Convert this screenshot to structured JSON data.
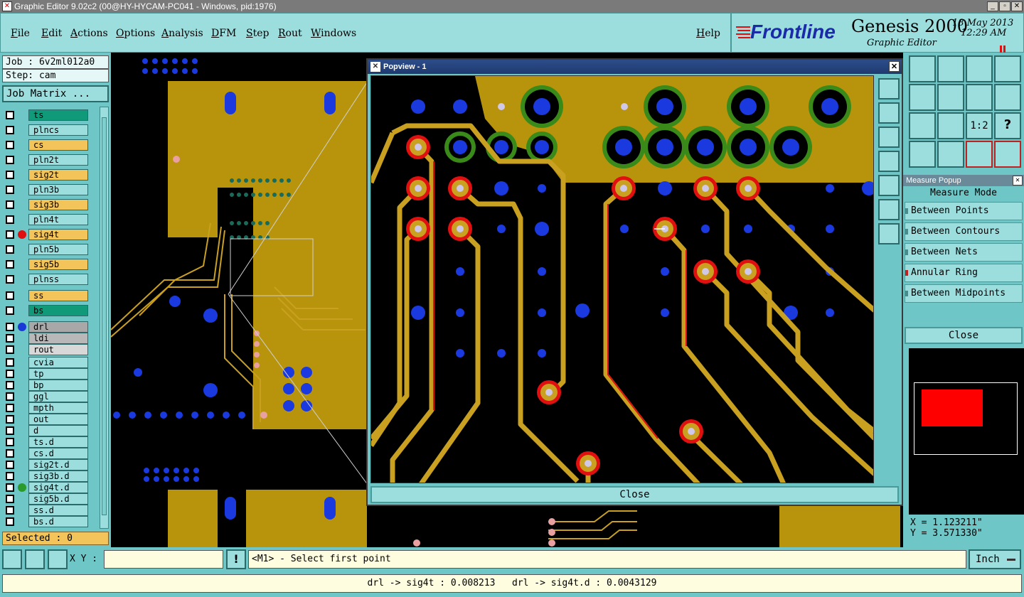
{
  "window": {
    "title": "Graphic Editor 9.02c2 (00@HY-HYCAM-PC041 - Windows, pid:1976)",
    "controls": [
      "_",
      "▫",
      "✕"
    ]
  },
  "menu": [
    "File",
    "Edit",
    "Actions",
    "Options",
    "Analysis",
    "DFM",
    "Step",
    "Rout",
    "Windows"
  ],
  "help_label": "Help",
  "brand": {
    "logo": "Frontline",
    "product": "Genesis 2000",
    "subtitle": "Graphic Editor",
    "date": "18 May 2013",
    "time": "12:29 AM"
  },
  "job": {
    "job_label": "Job : 6v2ml012a0",
    "step_label": "Step: cam",
    "matrix_button": "Job Matrix ..."
  },
  "layers": [
    {
      "name": "ts",
      "color": "#109a7a",
      "dot": ""
    },
    {
      "name": "plncs",
      "color": "#9cdede",
      "dot": ""
    },
    {
      "name": "cs",
      "color": "#f2c45a",
      "dot": ""
    },
    {
      "name": "pln2t",
      "color": "#9cdede",
      "dot": ""
    },
    {
      "name": "sig2t",
      "color": "#f2c45a",
      "dot": ""
    },
    {
      "name": "pln3b",
      "color": "#9cdede",
      "dot": ""
    },
    {
      "name": "sig3b",
      "color": "#f2c45a",
      "dot": ""
    },
    {
      "name": "pln4t",
      "color": "#9cdede",
      "dot": ""
    },
    {
      "name": "sig4t",
      "color": "#f2c45a",
      "dot": "#e01010"
    },
    {
      "name": "pln5b",
      "color": "#9cdede",
      "dot": ""
    },
    {
      "name": "sig5b",
      "color": "#f2c45a",
      "dot": ""
    },
    {
      "name": "plnss",
      "color": "#9cdede",
      "dot": ""
    },
    {
      "name": "ss",
      "color": "#f2c45a",
      "dot": ""
    },
    {
      "name": "bs",
      "color": "#109a7a",
      "dot": ""
    },
    {
      "name": "drl",
      "color": "#a8a8a8",
      "dot": "#1a3ad8"
    },
    {
      "name": "ldi",
      "color": "#b8b8b8",
      "dot": ""
    },
    {
      "name": "rout",
      "color": "#d8d8d8",
      "dot": ""
    },
    {
      "name": "cvia",
      "color": "#9cdede",
      "dot": ""
    },
    {
      "name": "tp",
      "color": "#9cdede",
      "dot": ""
    },
    {
      "name": "bp",
      "color": "#9cdede",
      "dot": ""
    },
    {
      "name": "ggl",
      "color": "#9cdede",
      "dot": ""
    },
    {
      "name": "mpth",
      "color": "#9cdede",
      "dot": ""
    },
    {
      "name": "out",
      "color": "#9cdede",
      "dot": ""
    },
    {
      "name": "d",
      "color": "#9cdede",
      "dot": ""
    },
    {
      "name": "ts.d",
      "color": "#9cdede",
      "dot": ""
    },
    {
      "name": "cs.d",
      "color": "#9cdede",
      "dot": ""
    },
    {
      "name": "sig2t.d",
      "color": "#9cdede",
      "dot": ""
    },
    {
      "name": "sig3b.d",
      "color": "#9cdede",
      "dot": ""
    },
    {
      "name": "sig4t.d",
      "color": "#9cdede",
      "dot": "#2a9a2a"
    },
    {
      "name": "sig5b.d",
      "color": "#9cdede",
      "dot": ""
    },
    {
      "name": "ss.d",
      "color": "#9cdede",
      "dot": ""
    },
    {
      "name": "bs.d",
      "color": "#9cdede",
      "dot": ""
    }
  ],
  "selected_label": "Selected : 0",
  "popview": {
    "title": "Popview - 1",
    "close_label": "Close"
  },
  "measure": {
    "popup_title": "Measure Popup",
    "mode_label": "Measure Mode",
    "options": [
      "Between Points",
      "Between Contours",
      "Between Nets",
      "Annular Ring",
      "Between Midpoints"
    ],
    "close_label": "Close"
  },
  "coords": {
    "x": "X = 1.123211\"",
    "y": "Y = 3.571330\""
  },
  "command": {
    "xy_label": "X Y :",
    "xy_value": "",
    "prompt": "<M1> - Select first point",
    "units": "Inch"
  },
  "status": "drl -> sig4t : 0.008213   drl -> sig4t.d : 0.0043129",
  "colors": {
    "copper": "#b8940c",
    "trace": "#c9a020",
    "drill": "#1a3ae0",
    "pad_red": "#e01010",
    "mask_green": "#3a8a1a",
    "panel": "#9cdede",
    "teal": "#6fc6c6"
  }
}
